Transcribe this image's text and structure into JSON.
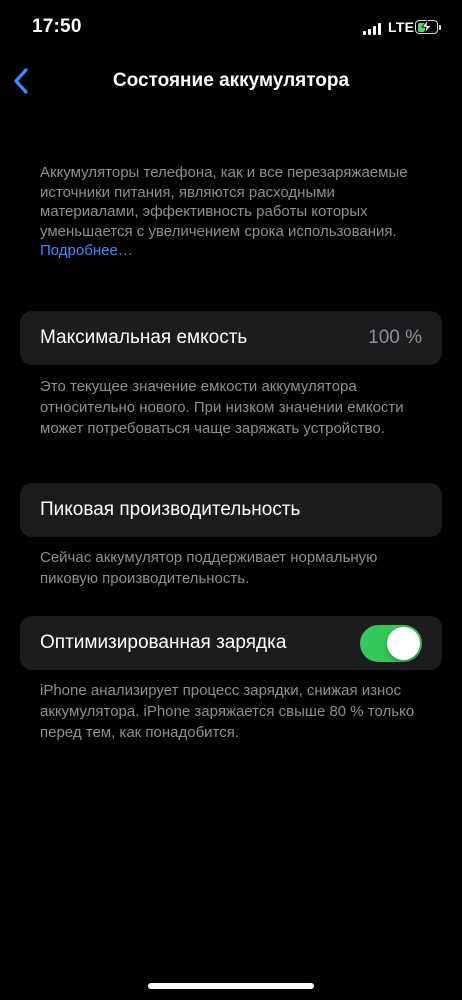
{
  "status_bar": {
    "time": "17:50",
    "network": "LTE",
    "signal_icon": "cellular-signal-icon",
    "battery_icon": "battery-charging-icon",
    "battery_level": 0.4,
    "battery_fill_color": "#4cd964"
  },
  "nav": {
    "back_icon": "chevron-left-icon",
    "title": "Состояние аккумулятора",
    "accent_color": "#3b8cff"
  },
  "intro": {
    "text": "Аккумуляторы телефона, как и все перезаряжаемые источники питания, являются расходными материалами, эффективность работы которых уменьшается с увеличением срока использования.",
    "link_label": "Подробнее…"
  },
  "max_capacity": {
    "label": "Максимальная емкость",
    "value": "100 %",
    "footer": "Это текущее значение емкости аккумулятора относительно нового. При низком значении емкости может потребоваться чаще заряжать устройство."
  },
  "peak_performance": {
    "label": "Пиковая производительность",
    "footer": "Сейчас аккумулятор поддерживает нормальную пиковую производительность."
  },
  "optimized_charging": {
    "label": "Оптимизированная зарядка",
    "enabled": true,
    "toggle_color": "#34c759",
    "footer": "iPhone анализирует процесс зарядки, снижая износ аккумулятора. iPhone заряжается свыше 80 % только перед тем, как понадобится."
  }
}
